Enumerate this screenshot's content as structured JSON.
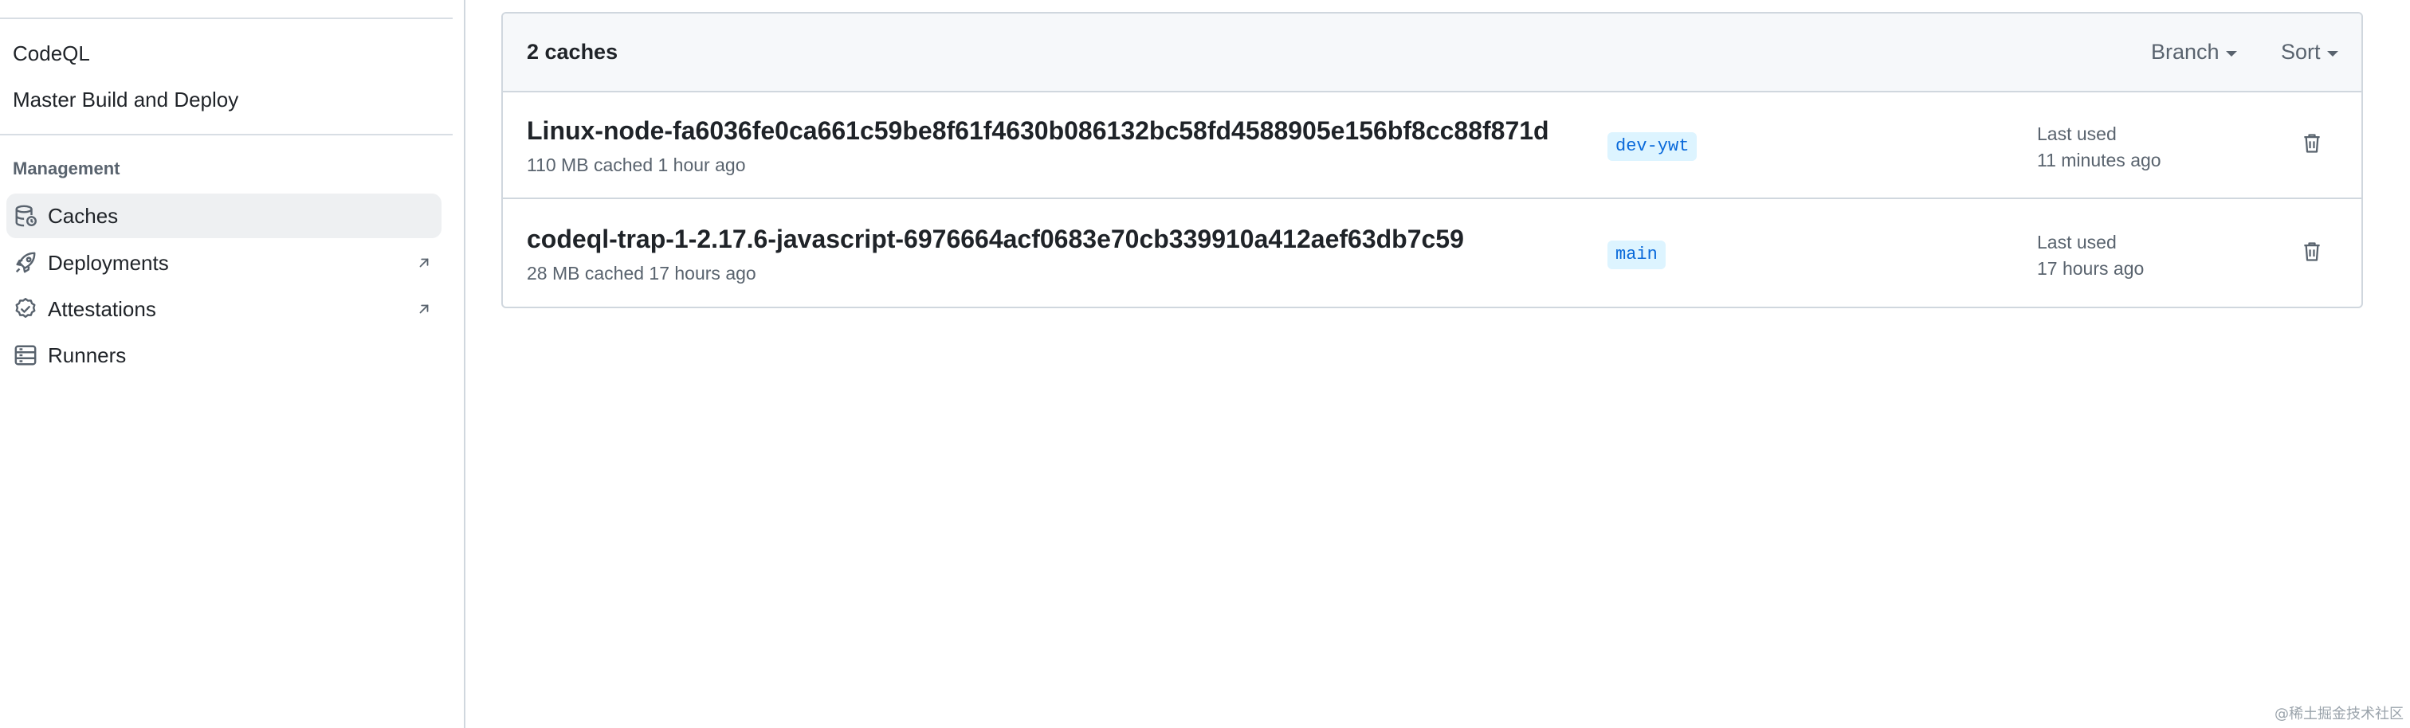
{
  "sidebar": {
    "links": [
      "CodeQL",
      "Master Build and Deploy"
    ],
    "group_heading": "Management",
    "items": [
      {
        "label": "Caches",
        "icon": "database-icon",
        "active": true,
        "external": false
      },
      {
        "label": "Deployments",
        "icon": "rocket-icon",
        "active": false,
        "external": true
      },
      {
        "label": "Attestations",
        "icon": "verified-icon",
        "active": false,
        "external": true
      },
      {
        "label": "Runners",
        "icon": "server-icon",
        "active": false,
        "external": false
      }
    ]
  },
  "caches": {
    "count_label": "2 caches",
    "filters": {
      "branch_label": "Branch",
      "sort_label": "Sort"
    },
    "rows": [
      {
        "name": "Linux-node-fa6036fe0ca661c59be8f61f4630b086132bc58fd4588905e156bf8cc88f871d",
        "meta": "110 MB cached 1 hour ago",
        "branch": "dev-ywt",
        "last_used_label": "Last used",
        "last_used_value": "11 minutes ago"
      },
      {
        "name": "codeql-trap-1-2.17.6-javascript-6976664acf0683e70cb339910a412aef63db7c59",
        "meta": "28 MB cached 17 hours ago",
        "branch": "main",
        "last_used_label": "Last used",
        "last_used_value": "17 hours ago"
      }
    ]
  },
  "watermark": "@稀土掘金技术社区",
  "colors": {
    "accent": "#0969da",
    "branch_bg": "#ddf4ff",
    "muted_text": "#59636e",
    "border": "#d0d7de",
    "active_bg": "#eef0f2"
  }
}
